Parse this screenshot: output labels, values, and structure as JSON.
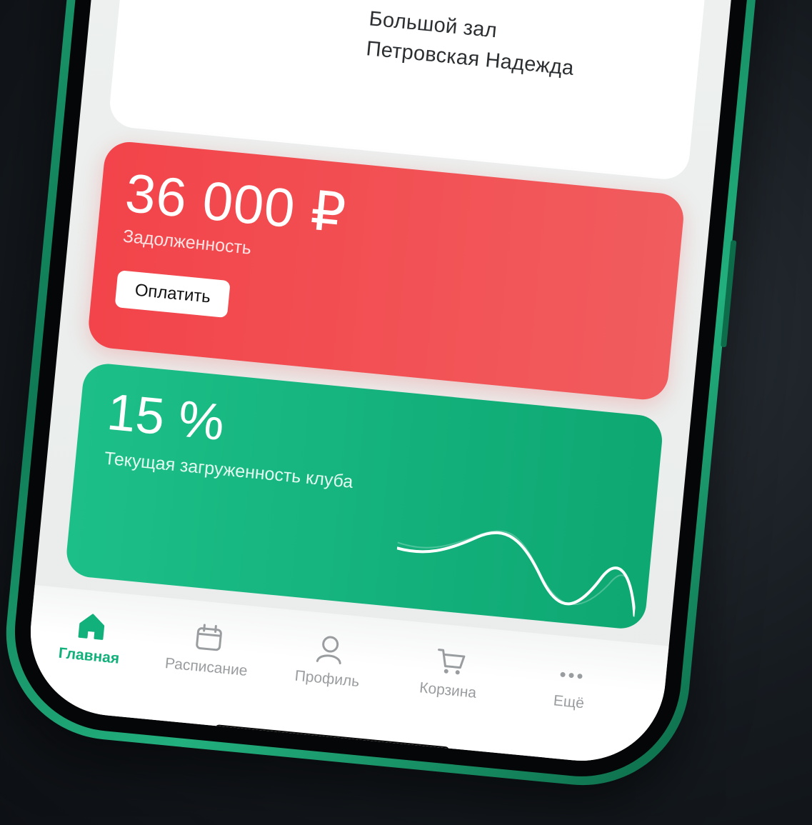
{
  "top_card": {
    "hall": "Большой зал",
    "coach": "Петровская Надежда"
  },
  "debt": {
    "amount": "36 000 ₽",
    "label": "Задолженность",
    "pay_button": "Оплатить",
    "color": "#f2444a"
  },
  "load": {
    "percent": "15 %",
    "value": 15,
    "label": "Текущая загруженность клуба",
    "color": "#14b17c"
  },
  "tabbar": {
    "items": [
      {
        "label": "Главная",
        "icon": "home-icon",
        "active": true
      },
      {
        "label": "Расписание",
        "icon": "calendar-icon",
        "active": false
      },
      {
        "label": "Профиль",
        "icon": "profile-icon",
        "active": false
      },
      {
        "label": "Корзина",
        "icon": "cart-icon",
        "active": false
      },
      {
        "label": "Ещё",
        "icon": "more-icon",
        "active": false
      }
    ],
    "active_color": "#12b07a",
    "inactive_color": "#9a9d9f"
  }
}
